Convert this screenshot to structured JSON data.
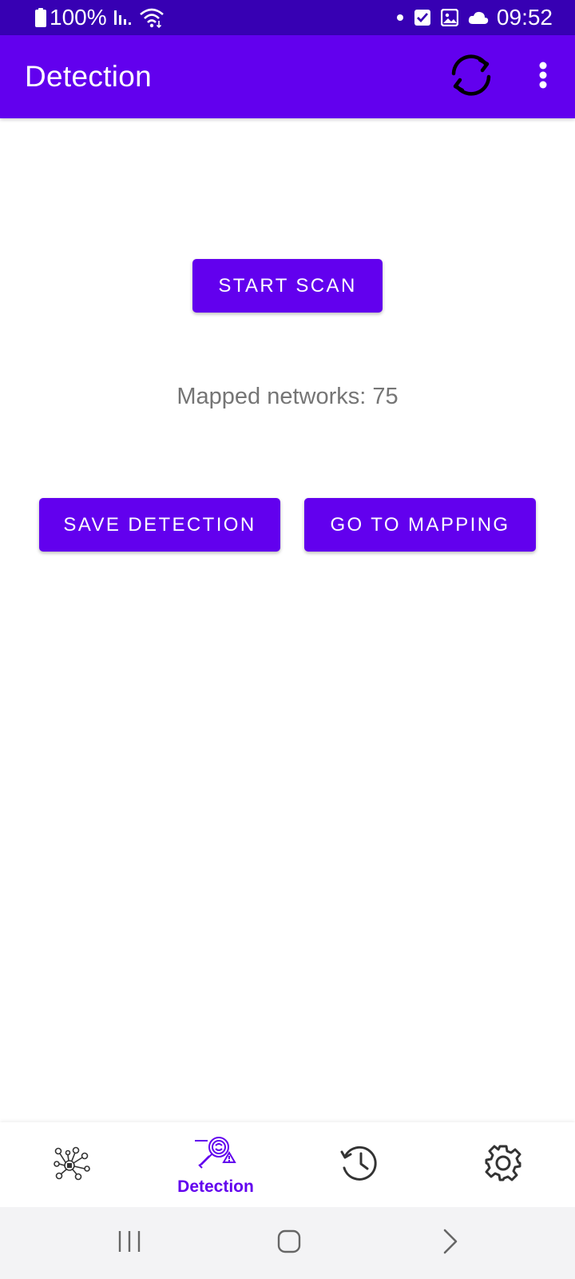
{
  "status_bar": {
    "battery_text": "100%",
    "time": "09:52",
    "left_icons": [
      "battery-icon",
      "signal-icon",
      "wifi-icon"
    ],
    "right_icons": [
      "dot-icon",
      "check-icon",
      "image-icon",
      "cloud-icon"
    ]
  },
  "app_bar": {
    "title": "Detection",
    "actions": [
      "refresh-icon",
      "overflow-menu-icon"
    ]
  },
  "main": {
    "start_scan_label": "START SCAN",
    "mapped_label": "Mapped networks:",
    "mapped_count": "75",
    "save_detection_label": "SAVE DETECTION",
    "go_to_mapping_label": "GO TO MAPPING"
  },
  "bottom_nav": {
    "items": [
      {
        "icon": "network-map-icon",
        "label": ""
      },
      {
        "icon": "detection-icon",
        "label": "Detection",
        "selected": true
      },
      {
        "icon": "history-icon",
        "label": ""
      },
      {
        "icon": "settings-icon",
        "label": ""
      }
    ]
  },
  "colors": {
    "primary": "#6200EE",
    "primary_dark": "#3700B3",
    "on_primary": "#FFFFFF",
    "secondary_text": "#757575",
    "icon_dark": "#333333"
  }
}
